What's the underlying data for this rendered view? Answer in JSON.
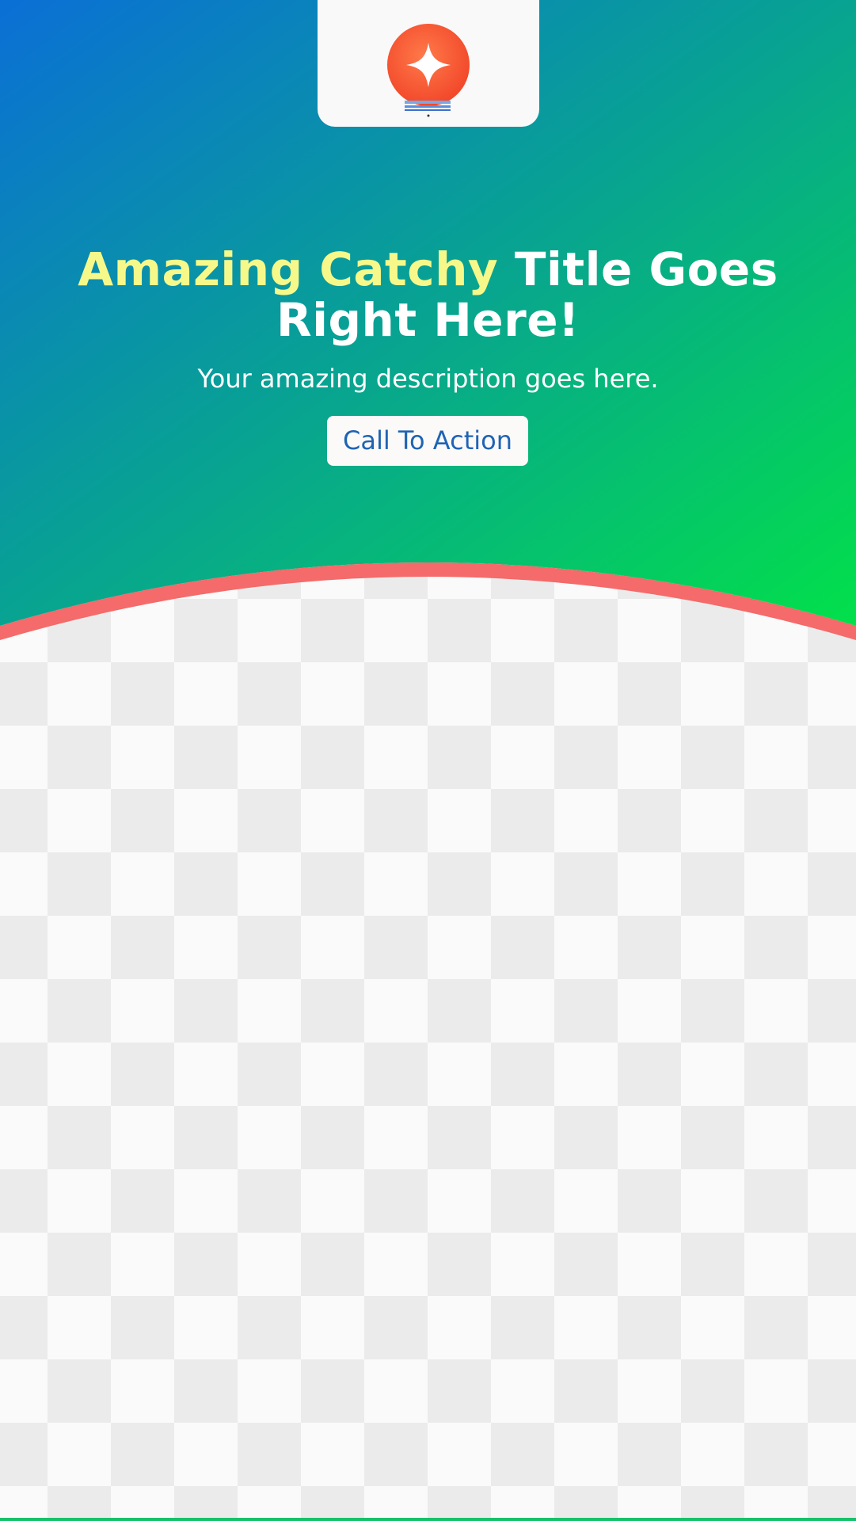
{
  "title": {
    "highlight": "Amazing Catchy",
    "rest_line1": " Title Goes",
    "line2": "Right Here!"
  },
  "description": "Your amazing description goes here.",
  "cta_label": "Call To Action",
  "logo": {
    "icon": "sparkle-bulb-icon"
  },
  "colors": {
    "gradient_start": "#0b6fd6",
    "gradient_end": "#05d84e",
    "accent_curve": "#f56a6a",
    "title_highlight": "#f6f98a",
    "cta_text": "#1f64b4",
    "logo_orange": "#f5542f"
  }
}
